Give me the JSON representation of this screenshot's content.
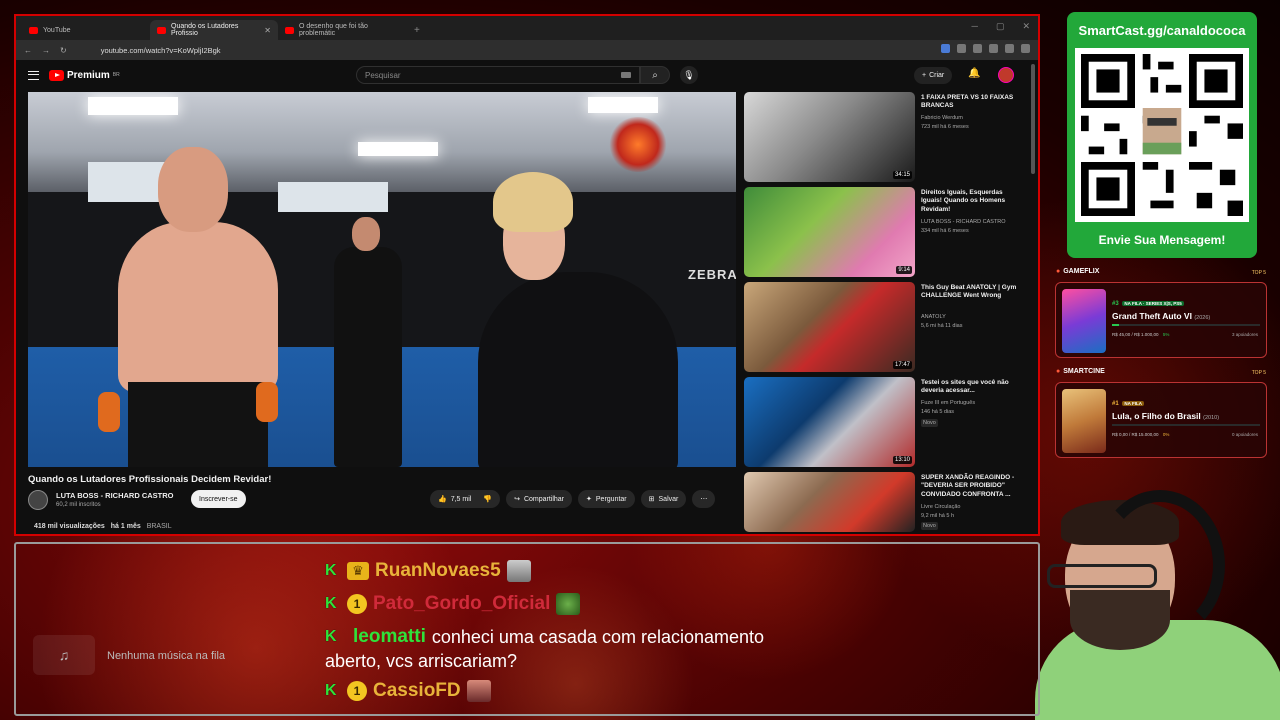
{
  "browser": {
    "tabs": [
      {
        "label": "YouTube",
        "active": false
      },
      {
        "label": "Quando os Lutadores Profissio",
        "active": true
      },
      {
        "label": "O desenho que foi tão problemátic",
        "active": false
      }
    ],
    "url": "youtube.com/watch?v=KoWpljI2Bgk"
  },
  "youtube": {
    "logo_text": "Premium",
    "logo_sup": "BR",
    "search_placeholder": "Pesquisar",
    "create_label": "Criar",
    "video": {
      "title": "Quando os Lutadores Profissionais Decidem Revidar!",
      "channel": "LUTA BOSS - RICHARD CASTRO",
      "subscribers": "60,2 mil inscritos",
      "subscribe_label": "Inscrever-se",
      "likes": "7,5 mil",
      "share_label": "Compartilhar",
      "ask_label": "Perguntar",
      "save_label": "Salvar",
      "views": "418 mil visualizações",
      "age": "há 1 mês",
      "country": "BRASIL"
    },
    "suggestions": [
      {
        "title": "1 FAIXA PRETA VS 10 FAIXAS BRANCAS",
        "channel": "Fabricio Werdum",
        "meta": "723 mil  há 6 meses",
        "duration": "34:15",
        "badge": ""
      },
      {
        "title": "Direitos Iguais, Esquerdas Iguais! Quando os Homens Revidam!",
        "channel": "LUTA BOSS - RICHARD CASTRO",
        "meta": "334 mil  há 6 meses",
        "duration": "9:14",
        "badge": ""
      },
      {
        "title": "This Guy Beat ANATOLY | Gym CHALLENGE Went Wrong",
        "channel": "ANATOLY",
        "meta": "5,6 mi  há 11 dias",
        "duration": "17:47",
        "badge": ""
      },
      {
        "title": "Testei os sites que você não deveria acessar...",
        "channel": "Fuze III em Português",
        "meta": "146  há 5 dias",
        "duration": "13:10",
        "badge": "Novo"
      },
      {
        "title": "SUPER XANDÃO REAGINDO - \"DEVERIA SER PROIBIDO\" CONVIDADO CONFRONTA ...",
        "channel": "Livre Circulação",
        "meta": "9,2 mil  há 5 h",
        "duration": "",
        "badge": "Novo"
      }
    ]
  },
  "overlay": {
    "qr_title": "SmartCast.gg/canaldococa",
    "qr_message": "Envie Sua Mensagem!",
    "gameflix": {
      "label": "GAMEFLIX",
      "top": "TOP 5",
      "rank": "#3",
      "tag": "NA FILA · SERIES X|S, PS5",
      "title": "Grand Theft Auto VI",
      "year": "(2026)",
      "price": "R$ 45,00 / R$ 1.000,00",
      "percent": "5%",
      "progress": 0.05,
      "supporters": "3 apoiadores"
    },
    "smartcine": {
      "label": "SMARTCINE",
      "top": "TOP 5",
      "rank": "#1",
      "tag": "NA FILA",
      "title": "Lula, o Filho do Brasil",
      "year": "(2010)",
      "price": "R$ 0,00 / R$ 15.000,00",
      "percent": "0%",
      "progress": 0,
      "supporters": "0 apoiadores"
    },
    "music_empty": "Nenhuma música na fila"
  },
  "chat": [
    {
      "user": "RuanNovaes5",
      "color": "#e8b33a",
      "badge": "crown",
      "text": ""
    },
    {
      "user": "Pato_Gordo_Oficial",
      "color": "#d02a3a",
      "badge": "1",
      "text": ""
    },
    {
      "user": "leomatti",
      "color": "#2fe23a",
      "badge": "",
      "text": "conheci uma casada com relacionamento",
      "text2": "aberto, vcs arriscariam?"
    },
    {
      "user": "CassioFD",
      "color": "#e8b33a",
      "badge": "1",
      "text": ""
    }
  ],
  "colors": {
    "frame_red": "#d40000",
    "qr_green": "#22a83a",
    "youtube_red": "#ff0000"
  }
}
